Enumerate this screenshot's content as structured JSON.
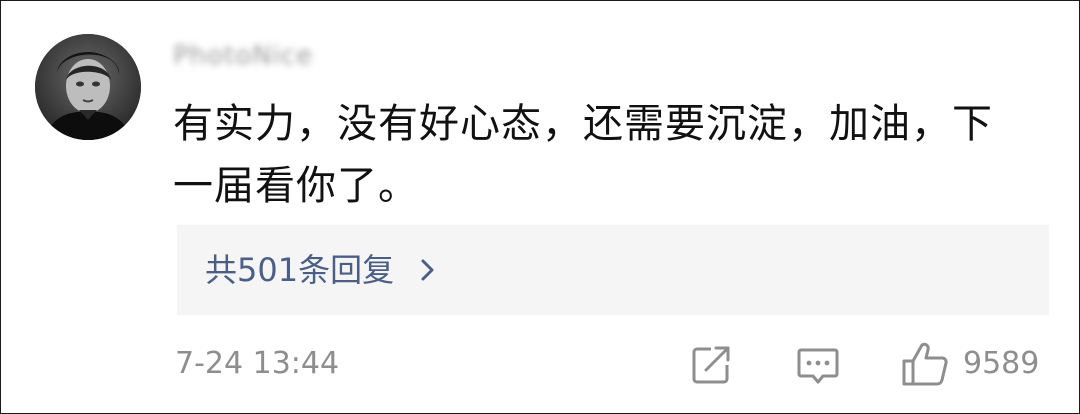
{
  "comment": {
    "username": "PhotoNice",
    "avatar_icon": "person-portrait-avatar",
    "text": "有实力，没有好心态，还需要沉淀，加油，下一届看你了。"
  },
  "replies": {
    "label": "共501条回复",
    "chevron_icon": "chevron-right-icon"
  },
  "footer": {
    "timestamp": "7-24 13:44",
    "share_icon": "share-icon",
    "comment_icon": "comment-icon",
    "like_icon": "thumbs-up-icon",
    "like_count": "9589"
  },
  "colors": {
    "text": "#111111",
    "muted": "#8e8e8e",
    "link": "#4b5f86",
    "replies_bg": "#f5f5f5"
  }
}
